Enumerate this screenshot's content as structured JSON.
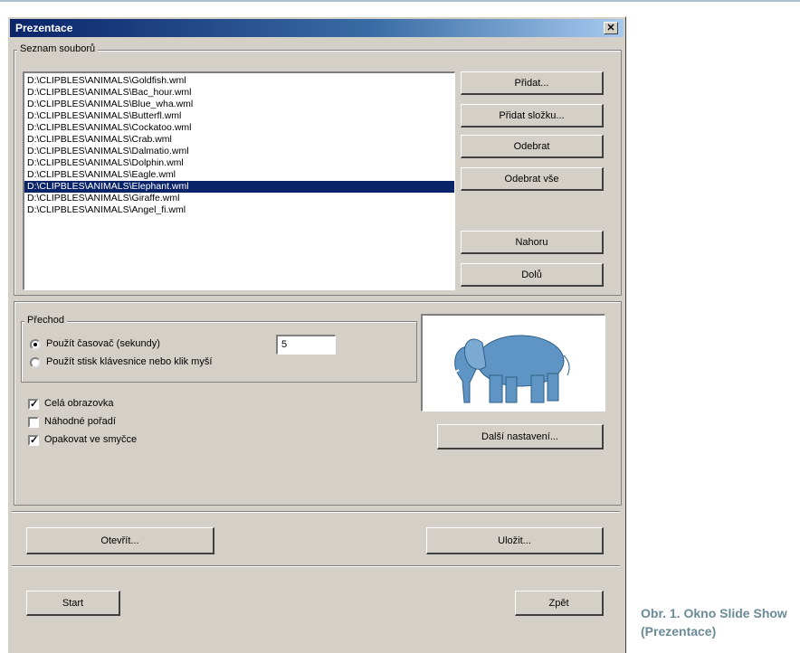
{
  "window": {
    "title": "Prezentace",
    "close_label": "✕"
  },
  "files": {
    "group_label": "Seznam souborů",
    "items": [
      "D:\\CLIPBLES\\ANIMALS\\Goldfish.wml",
      "D:\\CLIPBLES\\ANIMALS\\Bac_hour.wml",
      "D:\\CLIPBLES\\ANIMALS\\Blue_wha.wml",
      "D:\\CLIPBLES\\ANIMALS\\Butterfl.wml",
      "D:\\CLIPBLES\\ANIMALS\\Cockatoo.wml",
      "D:\\CLIPBLES\\ANIMALS\\Crab.wml",
      "D:\\CLIPBLES\\ANIMALS\\Dalmatio.wml",
      "D:\\CLIPBLES\\ANIMALS\\Dolphin.wml",
      "D:\\CLIPBLES\\ANIMALS\\Eagle.wml",
      "D:\\CLIPBLES\\ANIMALS\\Elephant.wml",
      "D:\\CLIPBLES\\ANIMALS\\Giraffe.wml",
      "D:\\CLIPBLES\\ANIMALS\\Angel_fi.wml"
    ],
    "selected_index": 9
  },
  "buttons": {
    "add": "Přidat...",
    "add_folder": "Přidat složku...",
    "remove": "Odebrat",
    "remove_all": "Odebrat vše",
    "up": "Nahoru",
    "down": "Dolů",
    "more_settings": "Další nastavení...",
    "open": "Otevřít...",
    "save": "Uložit...",
    "start": "Start",
    "back": "Zpět"
  },
  "transition": {
    "group_label": "Přechod",
    "option_timer": "Použít časovač (sekundy)",
    "option_key": "Použít stisk klávesnice nebo klik myší",
    "timer_value": "5"
  },
  "options": {
    "fullscreen": "Celá obrazovka",
    "random": "Náhodné pořadí",
    "loop": "Opakovat ve smyčce"
  },
  "caption": "Obr. 1. Okno Slide Show (Prezentace)"
}
